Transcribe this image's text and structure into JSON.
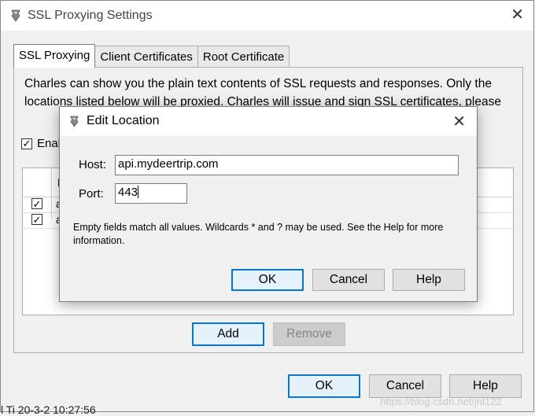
{
  "window": {
    "title": "SSL Proxying Settings",
    "close_glyph": "✕"
  },
  "tabs": [
    {
      "label": "SSL Proxying",
      "active": true
    },
    {
      "label": "Client Certificates",
      "active": false
    },
    {
      "label": "Root Certificate",
      "active": false
    }
  ],
  "panel": {
    "description": "Charles can show you the plain text contents of SSL requests and responses. Only the locations listed below will be proxied. Charles will issue and sign SSL certificates, please",
    "enable_label": "Enal",
    "enable_checked": true,
    "list_header": "L",
    "rows": [
      {
        "checked": true,
        "text": "a"
      },
      {
        "checked": true,
        "text": "a"
      }
    ],
    "add_label": "Add",
    "remove_label": "Remove"
  },
  "footer": {
    "ok_label": "OK",
    "cancel_label": "Cancel",
    "help_label": "Help"
  },
  "status_text": "l Ti          20-3-2 10:27:56",
  "watermark": "https://blog.csdn.net/jnl122",
  "edit_dialog": {
    "title": "Edit Location",
    "close_glyph": "✕",
    "host_label": "Host:",
    "host_value": "api.mydeertrip.com",
    "port_label": "Port:",
    "port_value": "443",
    "hint": "Empty fields match all values. Wildcards * and ? may be used. See the Help for more information.",
    "ok_label": "OK",
    "cancel_label": "Cancel",
    "help_label": "Help"
  },
  "colors": {
    "focus_border": "#0078d7",
    "background": "#f0f0f0"
  }
}
